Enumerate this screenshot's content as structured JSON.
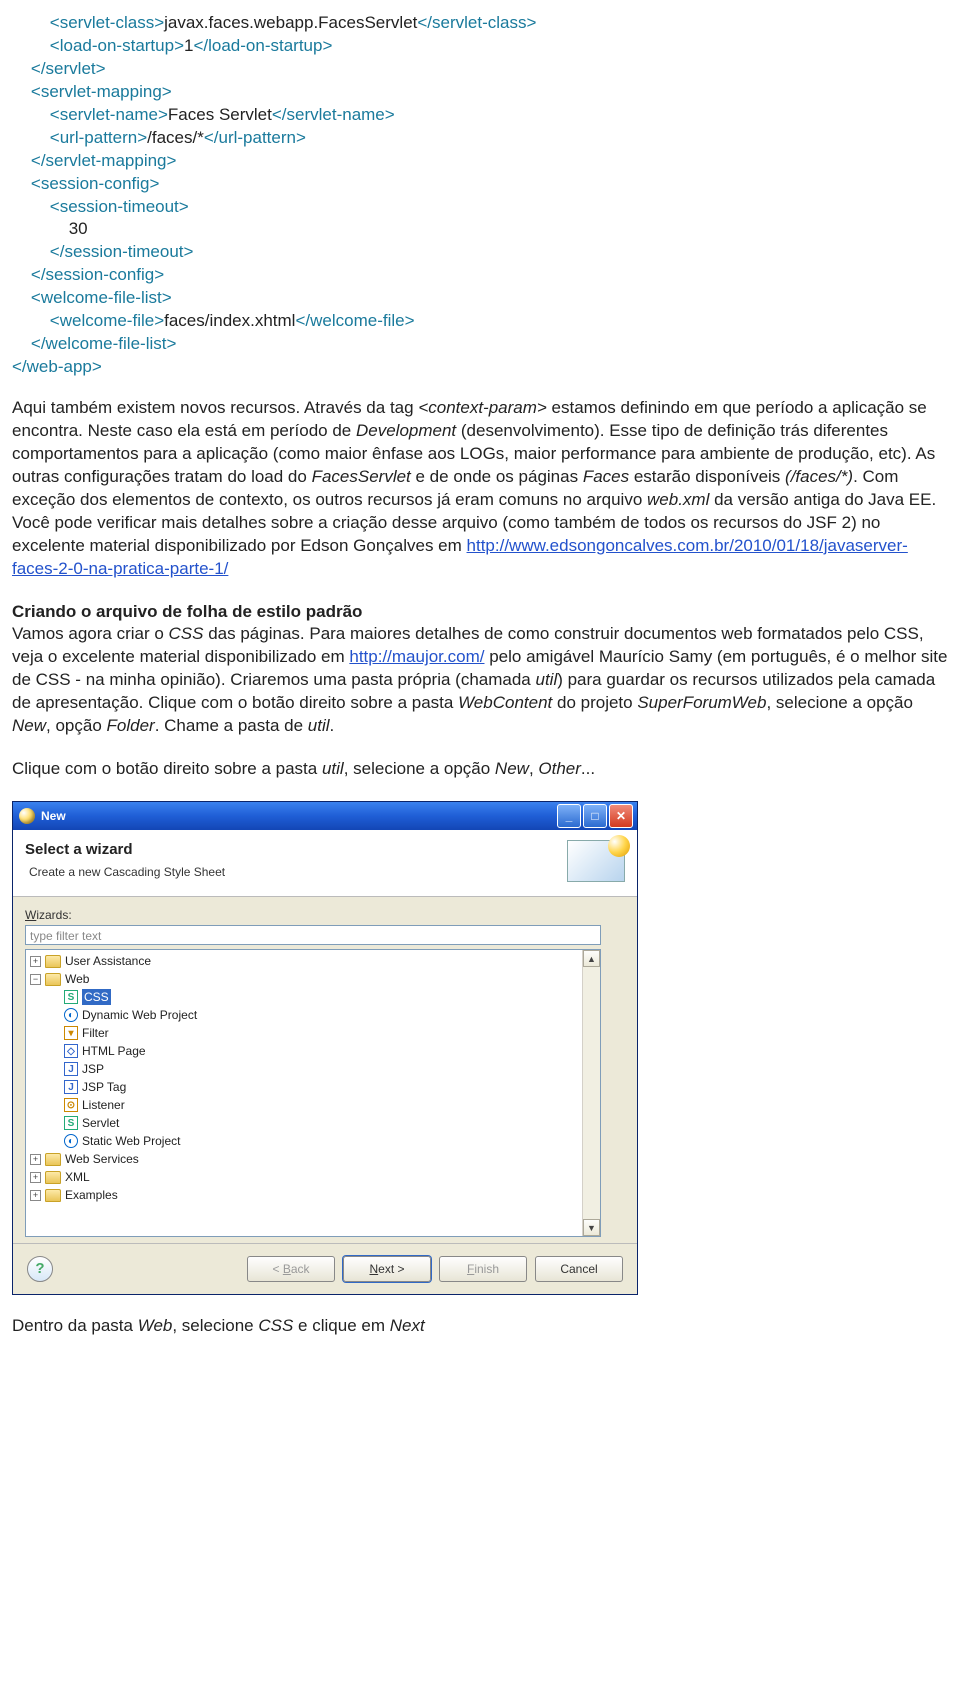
{
  "code": {
    "l1a": "<servlet-class>",
    "l1b": "javax.faces.webapp.FacesServlet",
    "l1c": "</servlet-class>",
    "l2a": "<load-on-startup>",
    "l2b": "1",
    "l2c": "</load-on-startup>",
    "l3": "</servlet>",
    "l4": "<servlet-mapping>",
    "l5a": "<servlet-name>",
    "l5b": "Faces Servlet",
    "l5c": "</servlet-name>",
    "l6a": "<url-pattern>",
    "l6b": "/faces/*",
    "l6c": "</url-pattern>",
    "l7": "</servlet-mapping>",
    "l8": "<session-config>",
    "l9": "<session-timeout>",
    "l10": "30",
    "l11": "</session-timeout>",
    "l12": "</session-config>",
    "l13": "<welcome-file-list>",
    "l14a": "<welcome-file>",
    "l14b": "faces/index.xhtml",
    "l14c": "</welcome-file>",
    "l15": "</welcome-file-list>",
    "l16": "</web-app>"
  },
  "para1": {
    "t1": "Aqui também existem novos recursos. Através da tag ",
    "i1": "<context-param>",
    "t2": " estamos definindo em que período a aplicação se encontra. Neste caso ela está em período de ",
    "i2": "Development",
    "t3": " (desenvolvimento). Esse tipo de definição trás diferentes comportamentos para a aplicação (como maior ênfase aos LOGs, maior performance para ambiente de produção, etc). As outras configurações tratam do load do ",
    "i3": "FacesServlet",
    "t4": " e de onde os páginas ",
    "i4": "Faces",
    "t5": " estarão disponíveis ",
    "i5": "(/faces/*)",
    "t6": ". Com exceção dos elementos de contexto, os outros recursos já eram comuns no arquivo ",
    "i6": "web.xml",
    "t7": " da versão antiga do Java EE. Você pode verificar mais detalhes sobre a criação desse arquivo (como também de todos os recursos do JSF 2) no excelente material disponibilizado por Edson Gonçalves em ",
    "link": "http://www.edsongoncalves.com.br/2010/01/18/javaserver-faces-2-0-na-pratica-parte-1/"
  },
  "heading": "Criando o arquivo de folha de estilo padrão",
  "para2": {
    "t1": "Vamos agora criar o ",
    "i1": "CSS",
    "t2": " das páginas. Para maiores detalhes de como construir documentos web formatados pelo CSS, veja o excelente material disponibilizado em ",
    "link": "http://maujor.com/",
    "t3": " pelo amigável Maurício Samy (em português, é o melhor site de CSS - na minha opinião). Criaremos uma pasta própria (chamada ",
    "i2": "util",
    "t4": ") para guardar os recursos utilizados pela camada de apresentação. Clique com o botão direito sobre a pasta ",
    "i3": "WebContent",
    "t5": " do projeto ",
    "i4": "SuperForumWeb",
    "t6": ", selecione a opção ",
    "i5": "New",
    "t7": ", opção ",
    "i6": "Folder",
    "t8": ". Chame a pasta de ",
    "i7": "util",
    "t9": "."
  },
  "para3": {
    "t1": "Clique com o botão direito sobre a pasta ",
    "i1": "util",
    "t2": ", selecione a opção ",
    "i2": "New",
    "t3": ", ",
    "i3": "Other",
    "t4": "..."
  },
  "dialog": {
    "title": "New",
    "bannerTitle": "Select a wizard",
    "bannerSub": "Create a new Cascading Style Sheet",
    "wizardsLabel": "Wizards:",
    "filterPlaceholder": "type filter text",
    "tree": {
      "userAssistance": "User Assistance",
      "web": "Web",
      "css": "CSS",
      "dwp": "Dynamic Web Project",
      "filter": "Filter",
      "html": "HTML Page",
      "jsp": "JSP",
      "jsptag": "JSP Tag",
      "listener": "Listener",
      "servlet": "Servlet",
      "swp": "Static Web Project",
      "ws": "Web Services",
      "xml": "XML",
      "ex": "Examples"
    },
    "buttons": {
      "back": "< Back",
      "next": "Next >",
      "finish": "Finish",
      "cancel": "Cancel"
    }
  },
  "footer": {
    "t1": "Dentro da pasta ",
    "i1": "Web",
    "t2": ", selecione ",
    "i2": "CSS",
    "t3": " e clique em ",
    "i3": "Next"
  }
}
